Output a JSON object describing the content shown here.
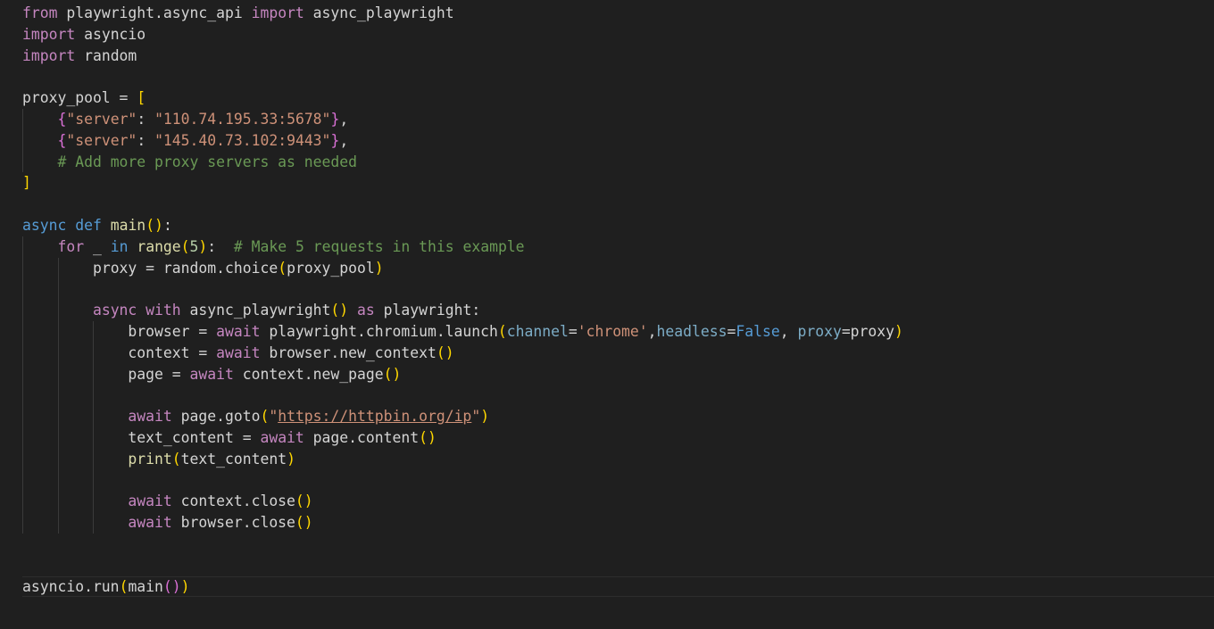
{
  "editor": {
    "lines": [
      [
        {
          "t": "from",
          "c": "kw-ctl"
        },
        {
          "t": " playwright.async_api ",
          "c": "plain"
        },
        {
          "t": "import",
          "c": "kw-ctl"
        },
        {
          "t": " async_playwright",
          "c": "plain"
        }
      ],
      [
        {
          "t": "import",
          "c": "kw-ctl"
        },
        {
          "t": " asyncio",
          "c": "plain"
        }
      ],
      [
        {
          "t": "import",
          "c": "kw-ctl"
        },
        {
          "t": " random",
          "c": "plain"
        }
      ],
      [],
      [
        {
          "t": "proxy_pool",
          "c": "plain"
        },
        {
          "t": " = ",
          "c": "plain"
        },
        {
          "t": "[",
          "c": "br1"
        }
      ],
      [
        {
          "t": "    ",
          "c": "plain"
        },
        {
          "t": "{",
          "c": "br2"
        },
        {
          "t": "\"server\"",
          "c": "str"
        },
        {
          "t": ": ",
          "c": "plain"
        },
        {
          "t": "\"110.74.195.33:5678\"",
          "c": "str"
        },
        {
          "t": "}",
          "c": "br2"
        },
        {
          "t": ",",
          "c": "plain"
        }
      ],
      [
        {
          "t": "    ",
          "c": "plain"
        },
        {
          "t": "{",
          "c": "br2"
        },
        {
          "t": "\"server\"",
          "c": "str"
        },
        {
          "t": ": ",
          "c": "plain"
        },
        {
          "t": "\"145.40.73.102:9443\"",
          "c": "str"
        },
        {
          "t": "}",
          "c": "br2"
        },
        {
          "t": ",",
          "c": "plain"
        }
      ],
      [
        {
          "t": "    ",
          "c": "plain"
        },
        {
          "t": "# Add more proxy servers as needed",
          "c": "cmt"
        }
      ],
      [
        {
          "t": "]",
          "c": "br1"
        }
      ],
      [],
      [
        {
          "t": "async",
          "c": "kw-decl"
        },
        {
          "t": " ",
          "c": "plain"
        },
        {
          "t": "def",
          "c": "kw-decl"
        },
        {
          "t": " ",
          "c": "plain"
        },
        {
          "t": "main",
          "c": "fn"
        },
        {
          "t": "()",
          "c": "br1"
        },
        {
          "t": ":",
          "c": "plain"
        }
      ],
      [
        {
          "t": "    ",
          "c": "plain"
        },
        {
          "t": "for",
          "c": "kw-ctl"
        },
        {
          "t": " _ ",
          "c": "plain"
        },
        {
          "t": "in",
          "c": "kw-decl"
        },
        {
          "t": " ",
          "c": "plain"
        },
        {
          "t": "range",
          "c": "fn"
        },
        {
          "t": "(",
          "c": "br1"
        },
        {
          "t": "5",
          "c": "num"
        },
        {
          "t": ")",
          "c": "br1"
        },
        {
          "t": ":  ",
          "c": "plain"
        },
        {
          "t": "# Make 5 requests in this example",
          "c": "cmt"
        }
      ],
      [
        {
          "t": "        ",
          "c": "plain"
        },
        {
          "t": "proxy",
          "c": "plain"
        },
        {
          "t": " = random.",
          "c": "plain"
        },
        {
          "t": "choice",
          "c": "plain"
        },
        {
          "t": "(",
          "c": "br1"
        },
        {
          "t": "proxy_pool",
          "c": "plain"
        },
        {
          "t": ")",
          "c": "br1"
        }
      ],
      [],
      [
        {
          "t": "        ",
          "c": "plain"
        },
        {
          "t": "async",
          "c": "kw-ctl"
        },
        {
          "t": " ",
          "c": "plain"
        },
        {
          "t": "with",
          "c": "kw-ctl"
        },
        {
          "t": " ",
          "c": "plain"
        },
        {
          "t": "async_playwright",
          "c": "plain"
        },
        {
          "t": "()",
          "c": "br1"
        },
        {
          "t": " ",
          "c": "plain"
        },
        {
          "t": "as",
          "c": "kw-ctl"
        },
        {
          "t": " playwright:",
          "c": "plain"
        }
      ],
      [
        {
          "t": "            ",
          "c": "plain"
        },
        {
          "t": "browser",
          "c": "plain"
        },
        {
          "t": " = ",
          "c": "plain"
        },
        {
          "t": "await",
          "c": "kw-ctl"
        },
        {
          "t": " playwright.chromium.launch",
          "c": "plain"
        },
        {
          "t": "(",
          "c": "br1"
        },
        {
          "t": "channel",
          "c": "param"
        },
        {
          "t": "=",
          "c": "plain"
        },
        {
          "t": "'chrome'",
          "c": "str"
        },
        {
          "t": ",",
          "c": "plain"
        },
        {
          "t": "headless",
          "c": "param"
        },
        {
          "t": "=",
          "c": "plain"
        },
        {
          "t": "False",
          "c": "const"
        },
        {
          "t": ", ",
          "c": "plain"
        },
        {
          "t": "proxy",
          "c": "param"
        },
        {
          "t": "=proxy",
          "c": "plain"
        },
        {
          "t": ")",
          "c": "br1"
        }
      ],
      [
        {
          "t": "            ",
          "c": "plain"
        },
        {
          "t": "context",
          "c": "plain"
        },
        {
          "t": " = ",
          "c": "plain"
        },
        {
          "t": "await",
          "c": "kw-ctl"
        },
        {
          "t": " browser.new_context",
          "c": "plain"
        },
        {
          "t": "()",
          "c": "br1"
        }
      ],
      [
        {
          "t": "            ",
          "c": "plain"
        },
        {
          "t": "page",
          "c": "plain"
        },
        {
          "t": " = ",
          "c": "plain"
        },
        {
          "t": "await",
          "c": "kw-ctl"
        },
        {
          "t": " context.new_page",
          "c": "plain"
        },
        {
          "t": "()",
          "c": "br1"
        }
      ],
      [],
      [
        {
          "t": "            ",
          "c": "plain"
        },
        {
          "t": "await",
          "c": "kw-ctl"
        },
        {
          "t": " page.goto",
          "c": "plain"
        },
        {
          "t": "(",
          "c": "br1"
        },
        {
          "t": "\"",
          "c": "str"
        },
        {
          "t": "https://httpbin.org/ip",
          "c": "url"
        },
        {
          "t": "\"",
          "c": "str"
        },
        {
          "t": ")",
          "c": "br1"
        }
      ],
      [
        {
          "t": "            ",
          "c": "plain"
        },
        {
          "t": "text_content",
          "c": "plain"
        },
        {
          "t": " = ",
          "c": "plain"
        },
        {
          "t": "await",
          "c": "kw-ctl"
        },
        {
          "t": " page.content",
          "c": "plain"
        },
        {
          "t": "()",
          "c": "br1"
        }
      ],
      [
        {
          "t": "            ",
          "c": "plain"
        },
        {
          "t": "print",
          "c": "fn"
        },
        {
          "t": "(",
          "c": "br1"
        },
        {
          "t": "text_content",
          "c": "plain"
        },
        {
          "t": ")",
          "c": "br1"
        }
      ],
      [],
      [
        {
          "t": "            ",
          "c": "plain"
        },
        {
          "t": "await",
          "c": "kw-ctl"
        },
        {
          "t": " context.close",
          "c": "plain"
        },
        {
          "t": "()",
          "c": "br1"
        }
      ],
      [
        {
          "t": "            ",
          "c": "plain"
        },
        {
          "t": "await",
          "c": "kw-ctl"
        },
        {
          "t": " browser.close",
          "c": "plain"
        },
        {
          "t": "()",
          "c": "br1"
        }
      ],
      [],
      [],
      [
        {
          "t": "asyncio.run",
          "c": "plain"
        },
        {
          "t": "(",
          "c": "br1"
        },
        {
          "t": "main",
          "c": "plain"
        },
        {
          "t": "()",
          "c": "br2"
        },
        {
          "t": ")",
          "c": "br1"
        }
      ]
    ]
  }
}
